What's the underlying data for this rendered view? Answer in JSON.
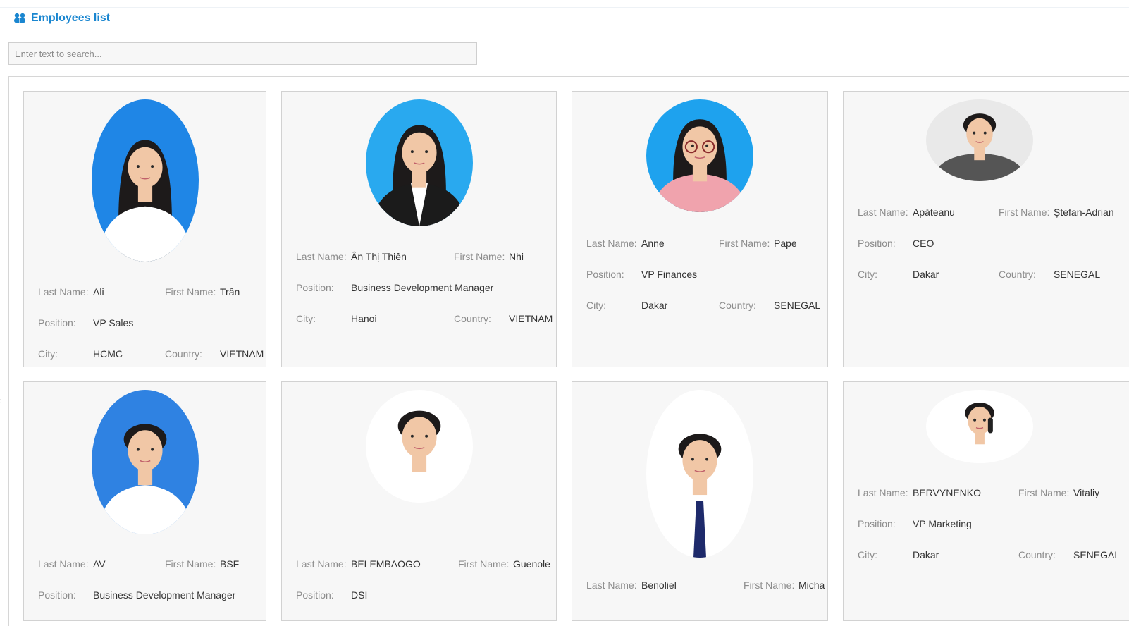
{
  "header": {
    "title": "Employees list",
    "icon": "users-icon",
    "accent": "#1a86d0"
  },
  "search": {
    "placeholder": "Enter text to search..."
  },
  "labels": {
    "last_name": "Last Name:",
    "first_name": "First Name:",
    "position": "Position:",
    "city": "City:",
    "country": "Country:"
  },
  "employees": [
    {
      "last_name": "Ali",
      "first_name": "Trần",
      "position": "VP Sales",
      "city": "HCMC",
      "country": "VIETNAM",
      "photo_bg": "#1f86e6"
    },
    {
      "last_name": "Ân Thị Thiên",
      "first_name": "Nhi",
      "position": "Business Development Manager",
      "city": "Hanoi",
      "country": "VIETNAM",
      "photo_bg": "#29a9ef"
    },
    {
      "last_name": "Anne",
      "first_name": "Pape",
      "position": "VP Finances",
      "city": "Dakar",
      "country": "SENEGAL",
      "photo_bg": "#1ea2ee"
    },
    {
      "last_name": "Apăteanu",
      "first_name": "Ștefan-Adrian",
      "position": "CEO",
      "city": "Dakar",
      "country": "SENEGAL",
      "photo_bg": "#e9e9e9"
    },
    {
      "last_name": "AV",
      "first_name": "BSF",
      "position": "Business Development Manager",
      "photo_bg": "#2f82e2"
    },
    {
      "last_name": "BELEMBAOGO",
      "first_name": "Guenole",
      "position": "DSI",
      "photo_bg": "#ffffff"
    },
    {
      "last_name": "Benoliel",
      "first_name": "Micha",
      "photo_bg": "#ffffff"
    },
    {
      "last_name": "BERVYNENKO",
      "first_name": "Vitaliy",
      "position": "VP Marketing",
      "city": "Dakar",
      "country": "SENEGAL",
      "photo_bg": "#ffffff"
    }
  ]
}
